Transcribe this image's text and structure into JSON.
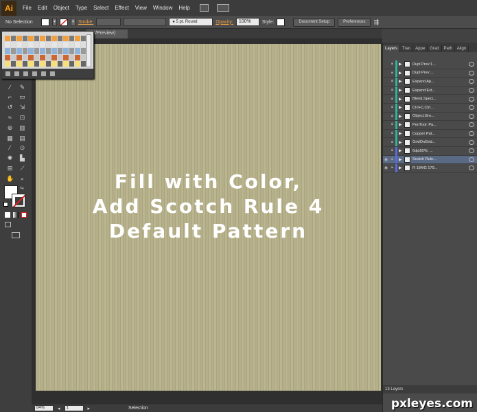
{
  "app": {
    "logo": "Ai",
    "menus": [
      "File",
      "Edit",
      "Object",
      "Type",
      "Select",
      "Effect",
      "View",
      "Window",
      "Help"
    ]
  },
  "control": {
    "selection_label": "No Selection",
    "stroke_label": "Stroke:",
    "brush_value": "5 pt. Round",
    "opacity_label": "Opacity:",
    "opacity_value": "100%",
    "style_label": "Style:",
    "document_setup": "Document Setup",
    "preferences": "Preferences"
  },
  "document": {
    "tab_label": "GB/Preview)",
    "overlay_lines": [
      "Fill with Color,",
      "Add Scotch Rule 4",
      "Default Pattern"
    ]
  },
  "status": {
    "zoom": "84%",
    "page": "1",
    "tool": "Selection"
  },
  "layers": {
    "tabs": [
      "Layers",
      "Tran",
      "Appe",
      "Grad",
      "Path",
      "Align"
    ],
    "rows": [
      {
        "name": "Dupl Prev:1...",
        "color": "#2fb39a",
        "selected": false,
        "visible": false
      },
      {
        "name": "Dupl Prev:...",
        "color": "#2fb39a",
        "selected": false,
        "visible": false
      },
      {
        "name": "Expand Ap...",
        "color": "#2fb39a",
        "selected": false,
        "visible": false
      },
      {
        "name": "Expand:Ext...",
        "color": "#2fb39a",
        "selected": false,
        "visible": false
      },
      {
        "name": "Blend,Speci...",
        "color": "#2fb39a",
        "selected": false,
        "visible": false
      },
      {
        "name": "Ctrl+C,Ctrl...",
        "color": "#2fb39a",
        "selected": false,
        "visible": false
      },
      {
        "name": "Object,Gro...",
        "color": "#2fb39a",
        "selected": false,
        "visible": false
      },
      {
        "name": "PenTool: Pa...",
        "color": "#2fb39a",
        "selected": false,
        "visible": false
      },
      {
        "name": "Copper Pat...",
        "color": "#2fb39a",
        "selected": false,
        "visible": false
      },
      {
        "name": "GridOnGrid...",
        "color": "#2fb39a",
        "selected": false,
        "visible": false
      },
      {
        "name": "6dpi50%: ...",
        "color": "#5a6be0",
        "selected": false,
        "visible": false
      },
      {
        "name": "Scotch Rule...",
        "color": "#5a6be0",
        "selected": true,
        "visible": true
      },
      {
        "name": "R 184/G 179...",
        "color": "#5a6be0",
        "selected": false,
        "visible": true
      }
    ],
    "count_label": "13 Layers"
  },
  "watermark": "pxleyes.com"
}
